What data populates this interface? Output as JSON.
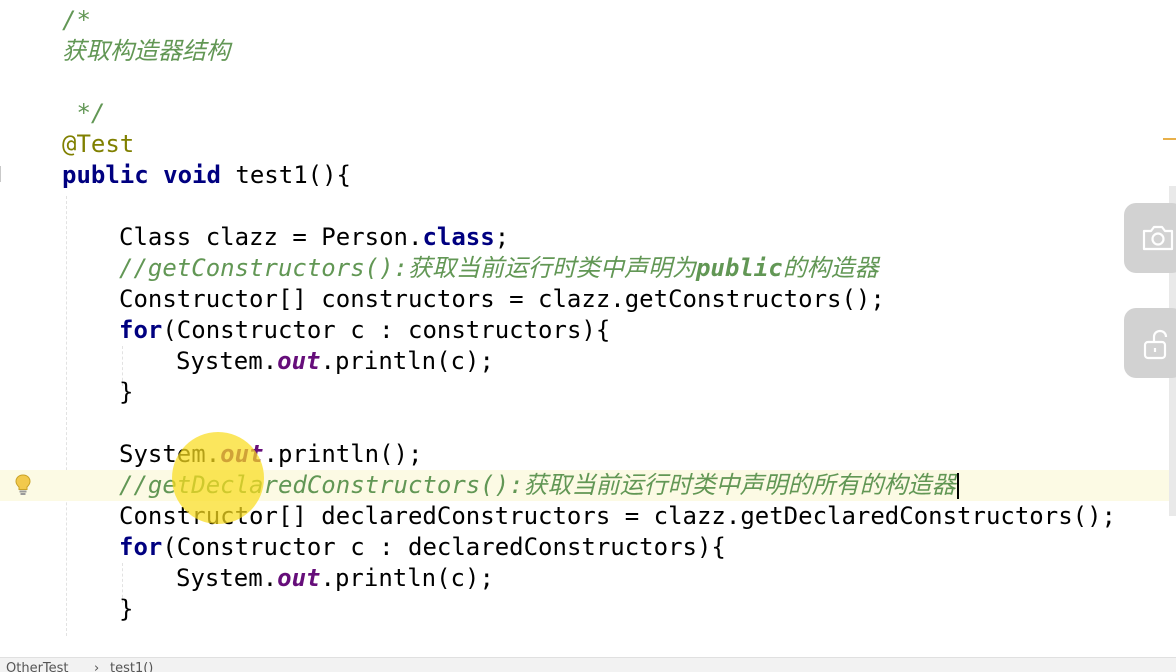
{
  "editor": {
    "lines": {
      "l1": "/*",
      "l2": "获取构造器结构",
      "l3": " */",
      "l4_annotation": "@Test",
      "l5_kw_public": "public",
      "l5_kw_void": "void",
      "l5_rest": " test1(){",
      "l6_type": "Class clazz = Person.",
      "l6_kw": "class",
      "l6_end": ";",
      "l7_comment_mono": "//getConstructors():",
      "l7_comment_cn1": "获取当前运行时类中声明为",
      "l7_comment_mono2": "public",
      "l7_comment_cn2": "的构造器",
      "l8": "Constructor[] constructors = clazz.getConstructors();",
      "l9_kw": "for",
      "l9_rest": "(Constructor c : constructors){",
      "l10_a": "System.",
      "l10_field": "out",
      "l10_b": ".println(c);",
      "l11": "}",
      "l12_a": "System.",
      "l12_field": "out",
      "l12_b": ".println();",
      "l13_comment_mono": "//getDeclaredConstructors():",
      "l13_comment_cn": "获取当前运行时类中声明的所有的构造器",
      "l14": "Constructor[] declaredConstructors = clazz.getDeclaredConstructors();",
      "l15_kw": "for",
      "l15_rest": "(Constructor c : declaredConstructors){",
      "l16_a": "System.",
      "l16_field": "out",
      "l16_b": ".println(c);",
      "l17": "}"
    }
  },
  "breadcrumb": {
    "class_name": "OtherTest",
    "separator": "›",
    "method_name": "test1()"
  },
  "icons": {
    "gutter": "lightbulb-icon",
    "float_top": "camera-icon",
    "float_bottom": "unlock-icon"
  },
  "colors": {
    "keyword": "#000080",
    "comment": "#629755",
    "annotation": "#808000",
    "field": "#660e7a",
    "current_line": "#fcfae4"
  }
}
